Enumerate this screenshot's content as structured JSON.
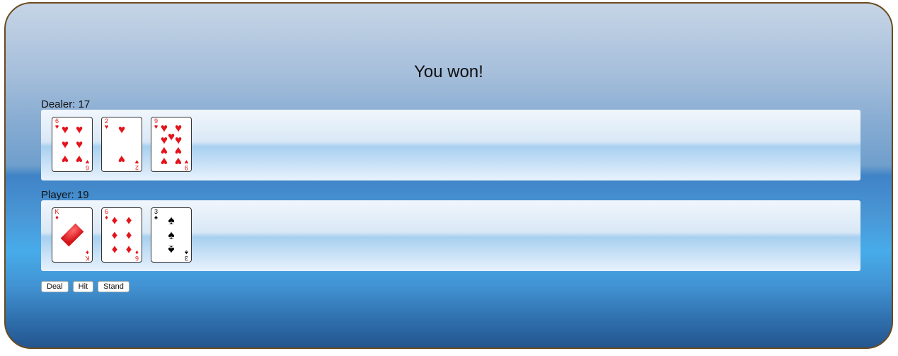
{
  "status_message": "You won!",
  "dealer": {
    "label": "Dealer: 17",
    "cards": [
      {
        "rank": "6",
        "suit": "♥",
        "color": "red"
      },
      {
        "rank": "2",
        "suit": "♥",
        "color": "red"
      },
      {
        "rank": "9",
        "suit": "♥",
        "color": "red"
      }
    ]
  },
  "player": {
    "label": "Player: 19",
    "cards": [
      {
        "rank": "K",
        "suit": "♦",
        "color": "red"
      },
      {
        "rank": "6",
        "suit": "♦",
        "color": "red"
      },
      {
        "rank": "3",
        "suit": "♠",
        "color": "black"
      }
    ]
  },
  "buttons": {
    "deal": "Deal",
    "hit": "Hit",
    "stand": "Stand"
  },
  "colors": {
    "card_red": "#e3141b",
    "card_black": "#000000",
    "board_border": "#6b4a1e"
  }
}
